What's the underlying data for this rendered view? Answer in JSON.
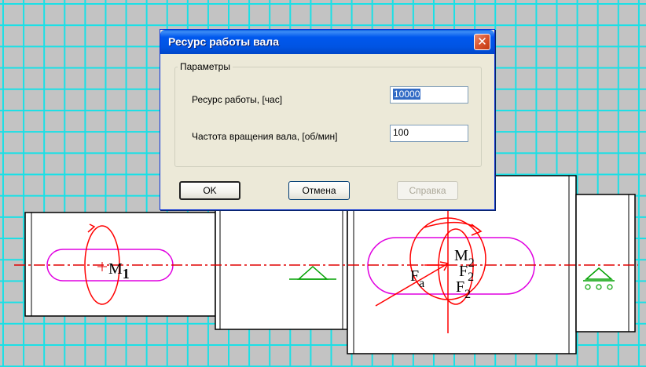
{
  "dialog": {
    "title": "Ресурс работы вала",
    "close_glyph": "✕",
    "group_label": "Параметры",
    "fields": {
      "resource": {
        "label": "Ресурс работы, [час]",
        "value": "10000"
      },
      "speed": {
        "label": "Частота вращения вала, [об/мин]",
        "value": "100"
      }
    },
    "buttons": {
      "ok": "OK",
      "cancel": "Отмена",
      "help": "Справка"
    }
  },
  "drawing": {
    "labels": {
      "m1": "M",
      "m1_sub": "1",
      "fa": "F",
      "fa_sub": "a",
      "m2": "M",
      "m2_sub": "2",
      "f2": "F",
      "f2_sub": "2",
      "f2b": "F",
      "f2b_sub": "2"
    },
    "colors": {
      "grid": "#19e0e6",
      "background": "#c3c3c3",
      "shaft_fill": "#ffffff",
      "keyway": "#e000e0",
      "centerline": "#e00000",
      "forces": "#ff0000",
      "support": "#00a000"
    },
    "icons": [
      "moment-arrow-icon",
      "fixed-support-icon",
      "roller-support-icon"
    ]
  }
}
